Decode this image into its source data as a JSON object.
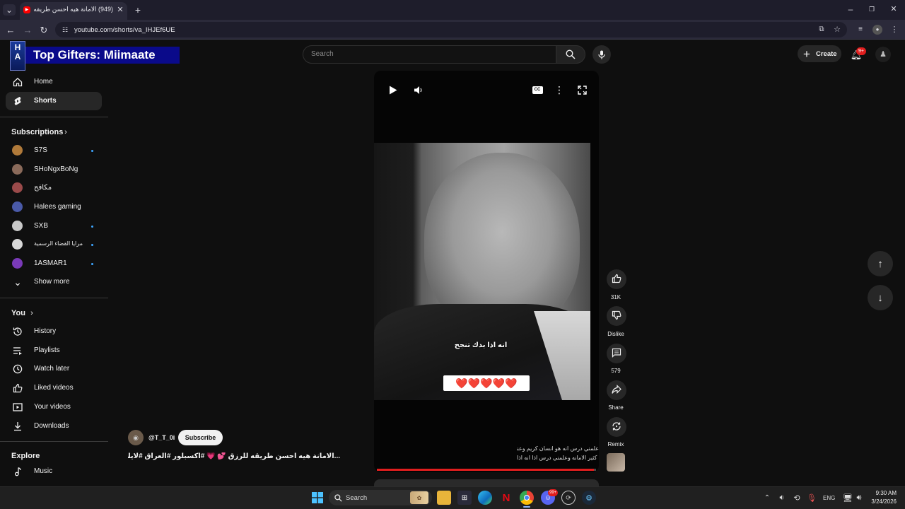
{
  "browser": {
    "tab_title": "(949) الامانة هيه احسن طريقه لل...",
    "url": "youtube.com/shorts/va_IHJEf6UE"
  },
  "overlay": {
    "banner_text": "Top Gifters: Miimaate",
    "logo_letters": "HA"
  },
  "header": {
    "search_placeholder": "Search",
    "create_label": "Create",
    "notification_count": "9+"
  },
  "sidebar": {
    "main": [
      {
        "label": "Home",
        "icon": "home-icon"
      },
      {
        "label": "Shorts",
        "icon": "shorts-icon",
        "active": true
      }
    ],
    "subscriptions_title": "Subscriptions",
    "subscriptions": [
      {
        "label": "S7S",
        "dot": true,
        "color": "#b07a3a"
      },
      {
        "label": "SHoNgxBoNg",
        "dot": false,
        "color": "#8a6a5a"
      },
      {
        "label": "مكافح",
        "dot": false,
        "color": "#9a4a4a"
      },
      {
        "label": "Halees gaming",
        "dot": false,
        "color": "#4a5aa8"
      },
      {
        "label": "SXB",
        "dot": true,
        "color": "#c8c8c8"
      },
      {
        "label": "مرايا القضاء الرسمية",
        "dot": true,
        "color": "#d8d8d8"
      },
      {
        "label": "1ASMAR1",
        "dot": true,
        "color": "#7a3ab8"
      }
    ],
    "show_more": "Show more",
    "you_title": "You",
    "you_items": [
      {
        "label": "History",
        "icon": "history-icon"
      },
      {
        "label": "Playlists",
        "icon": "playlists-icon"
      },
      {
        "label": "Watch later",
        "icon": "watch-later-icon"
      },
      {
        "label": "Liked videos",
        "icon": "like-icon"
      },
      {
        "label": "Your videos",
        "icon": "your-videos-icon"
      },
      {
        "label": "Downloads",
        "icon": "download-icon"
      }
    ],
    "explore_title": "Explore",
    "explore_items": [
      {
        "label": "Music",
        "icon": "music-icon"
      }
    ]
  },
  "short": {
    "channel": "@T_T_0i",
    "subscribe_label": "Subscribe",
    "caption": "...الامانة هيه احسن طريقه للرزق 💕 💗 #اكسبلور #العراق #لايك",
    "subtitle": "انه اذا بدك تنجح",
    "hearts": "❤️❤️❤️❤️❤️",
    "bottom_text_1": "علمني درس انه هو انسان كريم وعنده",
    "bottom_text_2": "كثير الامانه وعلمني درس اذا انه اذا",
    "progress": 0.99
  },
  "actions": {
    "like_count": "31K",
    "dislike_label": "Dislike",
    "comment_count": "579",
    "share_label": "Share",
    "remix_label": "Remix"
  },
  "taskbar": {
    "search_placeholder": "Search",
    "lang": "ENG",
    "time": "9:30 AM",
    "date": "3/24/2026",
    "discord_badge": "99+"
  }
}
